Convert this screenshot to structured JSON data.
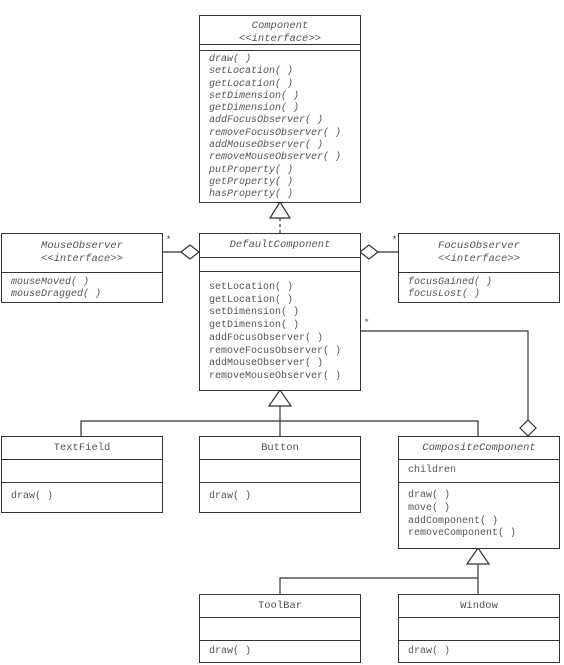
{
  "diagram_type": "UML class diagram",
  "classes": {
    "component": {
      "name": "Component",
      "stereotype": "<<interface>>",
      "attributes": [],
      "operations": [
        "draw( )",
        "setLocation( )",
        "getLocation( )",
        "setDimension( )",
        "getDimension( )",
        "addFocusObserver( )",
        "removeFocusObserver( )",
        "addMouseObserver( )",
        "removeMouseObserver( )",
        "putProperty( )",
        "getProperty( )",
        "hasProperty( )"
      ]
    },
    "mouse_observer": {
      "name": "MouseObserver",
      "stereotype": "<<interface>>",
      "operations": [
        "mouseMoved( )",
        "mouseDragged( )"
      ]
    },
    "default_component": {
      "name": "DefaultComponent",
      "attributes": [],
      "operations": [
        "setLocation( )",
        "getLocation( )",
        "setDimension( )",
        "getDimension( )",
        "addFocusObserver( )",
        "removeFocusObserver( )",
        "addMouseObserver( )",
        "removeMouseObserver( )"
      ]
    },
    "focus_observer": {
      "name": "FocusObserver",
      "stereotype": "<<interface>>",
      "operations": [
        "focusGained( )",
        "focusLost( )"
      ]
    },
    "text_field": {
      "name": "TextField",
      "attributes": [],
      "operations": [
        "draw( )"
      ]
    },
    "button": {
      "name": "Button",
      "attributes": [],
      "operations": [
        "draw( )"
      ]
    },
    "composite_component": {
      "name": "CompositeComponent",
      "attributes": [
        "children"
      ],
      "operations": [
        "draw( )",
        "move( )",
        "addComponent( )",
        "removeComponent( )"
      ]
    },
    "tool_bar": {
      "name": "ToolBar",
      "attributes": [],
      "operations": [
        "draw( )"
      ]
    },
    "window": {
      "name": "Window",
      "attributes": [],
      "operations": [
        "draw( )"
      ]
    }
  },
  "relationships": [
    {
      "type": "realization",
      "from": "DefaultComponent",
      "to": "Component"
    },
    {
      "type": "aggregation",
      "whole": "DefaultComponent",
      "part": "MouseObserver",
      "multiplicity": "*"
    },
    {
      "type": "aggregation",
      "whole": "DefaultComponent",
      "part": "FocusObserver",
      "multiplicity": "*"
    },
    {
      "type": "generalization",
      "from": "TextField",
      "to": "DefaultComponent"
    },
    {
      "type": "generalization",
      "from": "Button",
      "to": "DefaultComponent"
    },
    {
      "type": "generalization",
      "from": "CompositeComponent",
      "to": "DefaultComponent"
    },
    {
      "type": "aggregation",
      "whole": "CompositeComponent",
      "part": "DefaultComponent",
      "multiplicity": "*"
    },
    {
      "type": "generalization",
      "from": "ToolBar",
      "to": "CompositeComponent"
    },
    {
      "type": "generalization",
      "from": "Window",
      "to": "CompositeComponent"
    }
  ],
  "multiplicity_label": "*"
}
